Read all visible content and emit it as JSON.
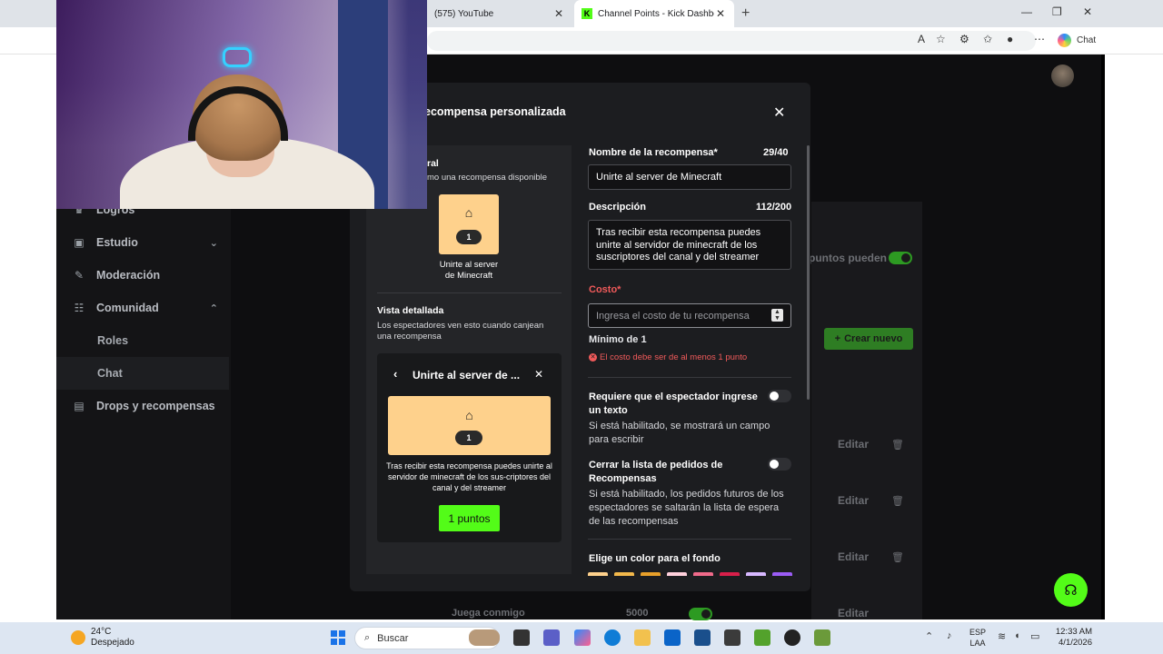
{
  "browser": {
    "tabs": [
      {
        "label": "(575) YouTube",
        "active": false
      },
      {
        "label": "Channel Points - Kick Dashboard",
        "active": true
      }
    ],
    "copilot_label": "Chat"
  },
  "sidebar": {
    "items": [
      {
        "label": "Logros",
        "icon": "trophy-icon"
      },
      {
        "label": "Estudio",
        "icon": "studio-icon"
      },
      {
        "label": "Moderación",
        "icon": "wrench-icon"
      },
      {
        "label": "Comunidad",
        "icon": "community-icon"
      },
      {
        "label": "Drops y recompensas",
        "icon": "drops-icon"
      }
    ],
    "sub_items": [
      "Roles",
      "Chat"
    ]
  },
  "background": {
    "toggle_label": "puntos pueden",
    "create_label": "Crear nuevo",
    "edit_label": "Editar",
    "row_title": "Juega conmigo",
    "row_cost": "5000"
  },
  "modal": {
    "title": "ecompensa personalizada",
    "preview": {
      "general_title": "ral",
      "general_sub": "mo una recompensa disponible",
      "tile_count": "1",
      "tile_name": "Unirte al server de Minecraft",
      "detail_title": "Vista detallada",
      "detail_sub": "Los espectadores ven esto cuando canjean una recompensa",
      "card_title": "Unirte al server de ...",
      "card_desc": "Tras recibir esta recompensa puedes unirte al servidor de minecraft de los sus-criptores del canal y del streamer",
      "points_button": "1 puntos"
    },
    "form": {
      "name_label": "Nombre de la recompensa*",
      "name_count": "29/40",
      "name_value": "Unirte al server de Minecraft",
      "desc_label": "Descripción",
      "desc_count": "112/200",
      "desc_value": "Tras recibir esta recompensa puedes unirte al servidor de minecraft de los suscriptores del canal y del streamer",
      "cost_label": "Costo*",
      "cost_placeholder": "Ingresa el costo de tu recompensa",
      "cost_min": "Mínimo de 1",
      "cost_error": "El costo debe ser de al menos 1 punto",
      "require_text_label": "Requiere que el espectador ingrese un texto",
      "require_text_help": "Si está habilitado, se mostrará un campo para escribir",
      "close_queue_label": "Cerrar la lista de pedidos de Recompensas",
      "close_queue_help": "Si está habilitado, los pedidos futuros de los espectadores se saltarán la lista de espera de las recompensas",
      "color_label": "Elige un color para el fondo"
    },
    "colors": [
      "#fed18c",
      "#f2b84b",
      "#e8a02a",
      "#ffd0dc",
      "#f06a8a",
      "#d81f4a",
      "#d7b8ff",
      "#9b5cf5"
    ]
  },
  "taskbar": {
    "temp": "24°C",
    "weather": "Despejado",
    "search_placeholder": "Buscar",
    "lang_1": "ESP",
    "lang_2": "LAA",
    "time": "12:33 AM",
    "date": "4/1/2026"
  }
}
